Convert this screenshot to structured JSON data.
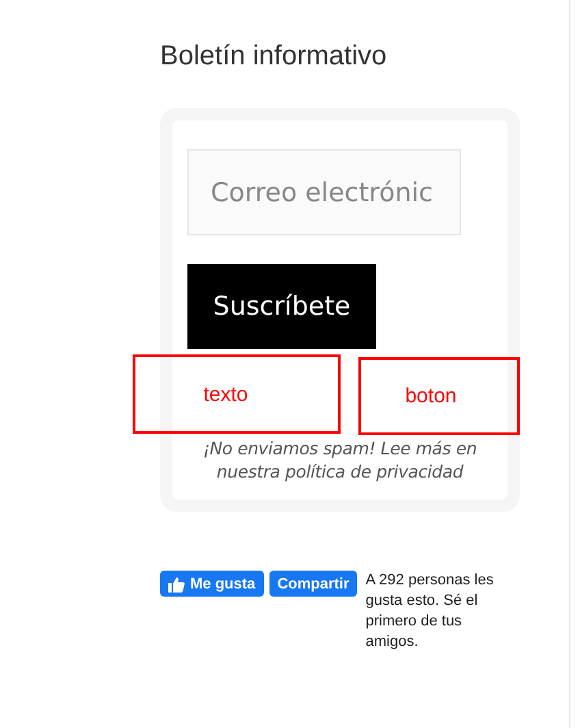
{
  "newsletter": {
    "title": "Boletín informativo",
    "email_field": {
      "placeholder": "Correo electrónic"
    },
    "subscribe_button": "Suscríbete",
    "disclaimer": "¡No enviamos spam! Lee más en nuestra política de privacidad"
  },
  "annotations": [
    {
      "label": "texto"
    },
    {
      "label": "boton"
    }
  ],
  "facebook": {
    "like_button": "Me gusta",
    "share_button": "Compartir",
    "social_text": "A 292 personas les gusta esto. Sé el primero de tus amigos."
  }
}
